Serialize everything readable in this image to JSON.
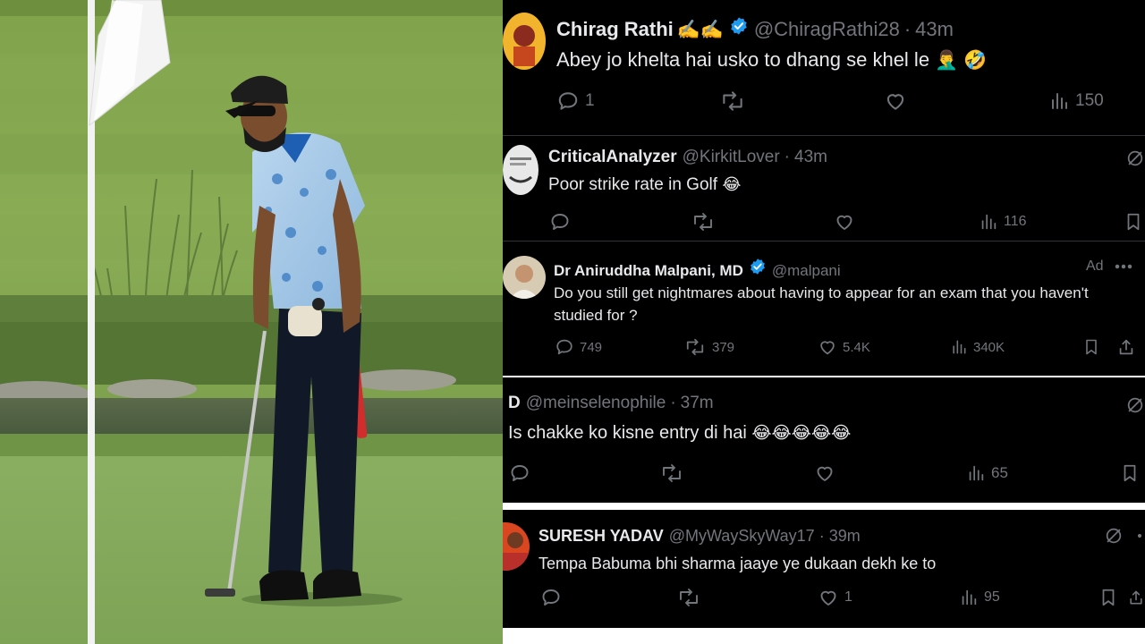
{
  "photo": {
    "alt_icon": "golfer-photo"
  },
  "tweets": [
    {
      "name": "Chirag Rathi",
      "name_emoji": "✍️✍️",
      "verified": true,
      "handle": "@ChiragRathi28",
      "time": "43m",
      "text": "Abey jo khelta hai usko to dhang se khel le",
      "text_emoji": "🤦‍♂️ 🤣",
      "replies": "1",
      "retweets": "",
      "likes": "",
      "views": "150"
    },
    {
      "name": "CriticalAnalyzer",
      "verified": false,
      "handle": "@KirkitLover",
      "time": "43m",
      "text": "Poor strike rate in Golf",
      "text_emoji": "😂",
      "replies": "",
      "retweets": "",
      "likes": "",
      "views": "116"
    },
    {
      "name": "Dr Aniruddha Malpani, MD",
      "verified": true,
      "handle": "@malpani",
      "ad_label": "Ad",
      "text": "Do you still get nightmares about having to appear for an exam that you haven't studied for ?",
      "replies": "749",
      "retweets": "379",
      "likes": "5.4K",
      "views": "340K"
    },
    {
      "name": "D",
      "verified": false,
      "handle": "@meinselenophile",
      "time": "37m",
      "text": "Is chakke ko kisne entry di hai",
      "text_emoji": "😂😂😂😂😂",
      "replies": "",
      "retweets": "",
      "likes": "",
      "views": "65"
    },
    {
      "name": "SURESH YADAV",
      "verified": false,
      "handle": "@MyWaySkyWay17",
      "time": "39m",
      "text": "Tempa Babuma bhi sharma jaaye ye dukaan dekh ke to",
      "replies": "",
      "retweets": "",
      "likes": "1",
      "views": "95"
    }
  ],
  "colors": {
    "background": "#000000",
    "text": "#e7e9ea",
    "muted": "#71767b",
    "verified": "#1d9bf0",
    "divider": "#2f3336"
  }
}
